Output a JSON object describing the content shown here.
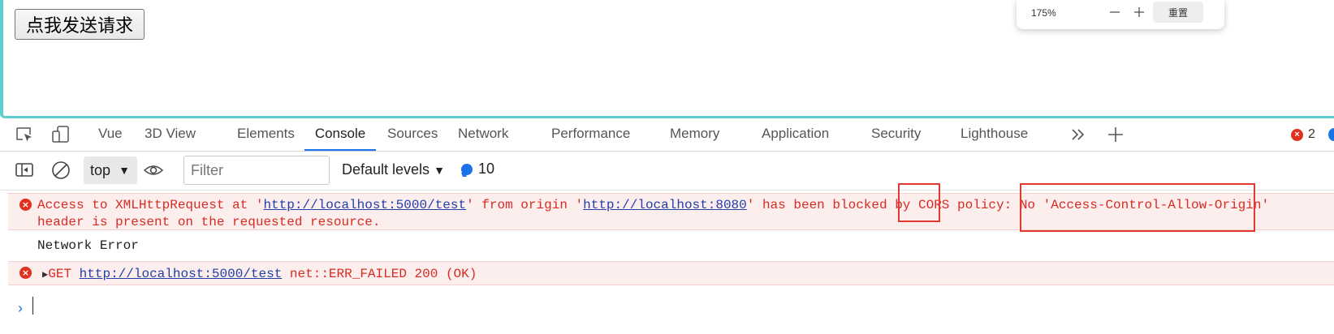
{
  "page": {
    "button_label": "点我发送请求"
  },
  "zoom_popup": {
    "percent": "175%",
    "minus_icon": "minus-icon",
    "plus_icon": "plus-icon",
    "reset_label": "重置"
  },
  "devtools": {
    "tabs": [
      {
        "label": "Vue"
      },
      {
        "label": "3D View"
      },
      {
        "label": "Elements"
      },
      {
        "label": "Console",
        "active": true
      },
      {
        "label": "Sources"
      },
      {
        "label": "Network"
      },
      {
        "label": "Performance"
      },
      {
        "label": "Memory"
      },
      {
        "label": "Application"
      },
      {
        "label": "Security"
      },
      {
        "label": "Lighthouse"
      }
    ],
    "error_count": "2",
    "icons": [
      "inspect-element-icon",
      "device-toolbar-icon",
      "more-tabs-icon",
      "add-tab-icon"
    ]
  },
  "console_toolbar": {
    "context": "top",
    "filter_placeholder": "Filter",
    "levels_label": "Default levels",
    "message_count": "10"
  },
  "messages": {
    "cors_error": {
      "p1": "Access to XMLHttpRequest at '",
      "url1": "http://localhost:5000/test",
      "p2": "' from origin '",
      "url2": "http://localhost:8080",
      "p3": "' has been blocked by ",
      "cors": "CORS",
      "p4": " policy: No ",
      "header_name": "'Access-Control-Allow-Origin'",
      "line2": "header is present on the requested resource."
    },
    "network_error": "Network Error",
    "get_error": {
      "method": "GET",
      "url": "http://localhost:5000/test",
      "status": "net::ERR_FAILED 200 (OK)"
    }
  },
  "colors": {
    "accent": "#1a73e8",
    "error_text": "#d72b21",
    "error_bg": "#fdeeee",
    "page_border": "#5ecfd0",
    "highlight_box": "#e23a30"
  }
}
